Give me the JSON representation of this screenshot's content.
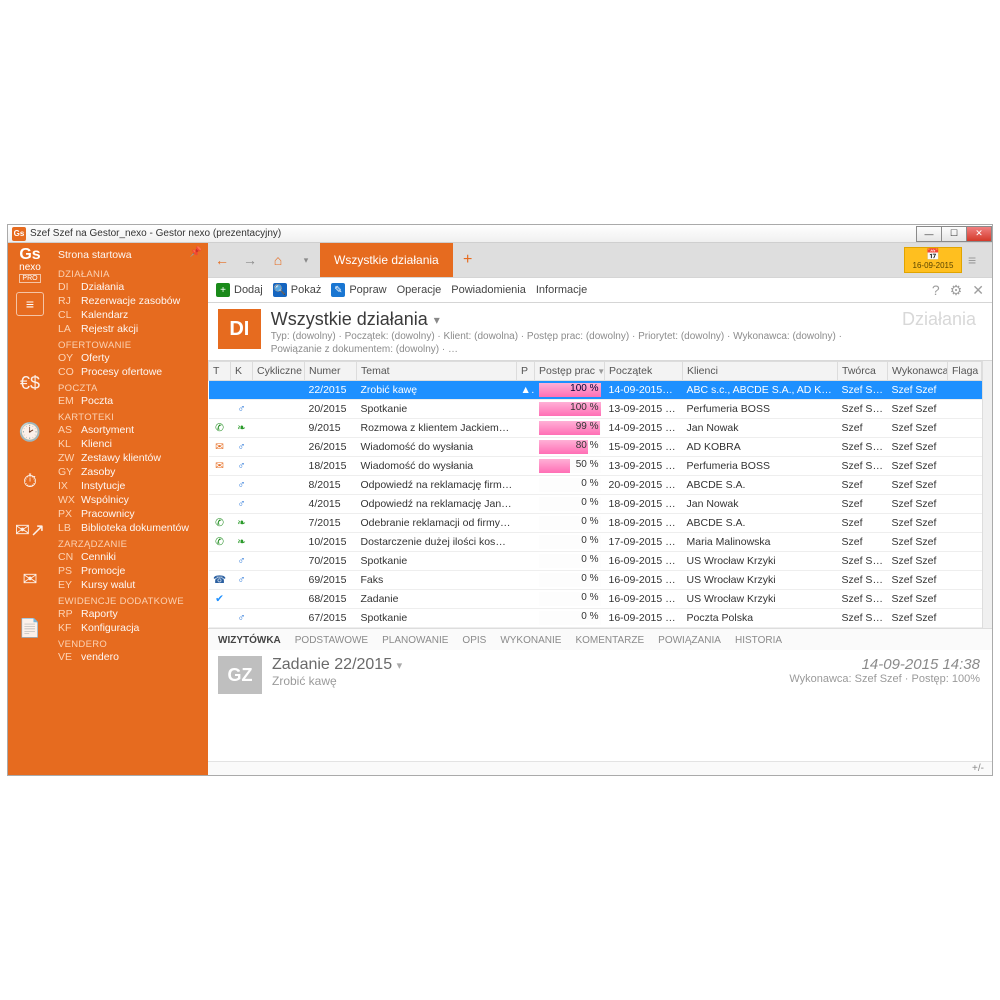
{
  "window": {
    "title": "Szef Szef na Gestor_nexo - Gestor nexo (prezentacyjny)",
    "logo_line1": "Gs",
    "logo_line2": "nexo",
    "logo_line3": "PRO"
  },
  "nav": {
    "start": "Strona startowa",
    "groups": [
      {
        "label": "DZIAŁANIA",
        "items": [
          {
            "code": "DI",
            "label": "Działania"
          },
          {
            "code": "RJ",
            "label": "Rezerwacje zasobów"
          },
          {
            "code": "CL",
            "label": "Kalendarz"
          },
          {
            "code": "LA",
            "label": "Rejestr akcji"
          }
        ]
      },
      {
        "label": "OFERTOWANIE",
        "items": [
          {
            "code": "OY",
            "label": "Oferty"
          },
          {
            "code": "CO",
            "label": "Procesy ofertowe"
          }
        ]
      },
      {
        "label": "POCZTA",
        "items": [
          {
            "code": "EM",
            "label": "Poczta"
          }
        ]
      },
      {
        "label": "KARTOTEKI",
        "items": [
          {
            "code": "AS",
            "label": "Asortyment"
          },
          {
            "code": "KL",
            "label": "Klienci"
          },
          {
            "code": "ZW",
            "label": "Zestawy klientów"
          },
          {
            "code": "GY",
            "label": "Zasoby"
          },
          {
            "code": "IX",
            "label": "Instytucje"
          },
          {
            "code": "WX",
            "label": "Wspólnicy"
          },
          {
            "code": "PX",
            "label": "Pracownicy"
          },
          {
            "code": "LB",
            "label": "Biblioteka dokumentów"
          }
        ]
      },
      {
        "label": "ZARZĄDZANIE",
        "items": [
          {
            "code": "CN",
            "label": "Cenniki"
          },
          {
            "code": "PS",
            "label": "Promocje"
          },
          {
            "code": "EY",
            "label": "Kursy walut"
          }
        ]
      },
      {
        "label": "EWIDENCJE DODATKOWE",
        "items": [
          {
            "code": "RP",
            "label": "Raporty"
          },
          {
            "code": "KF",
            "label": "Konfiguracja"
          }
        ]
      },
      {
        "label": "VENDERO",
        "items": [
          {
            "code": "VE",
            "label": "vendero"
          }
        ]
      }
    ]
  },
  "tabbar": {
    "tab": "Wszystkie działania",
    "date": "16-09-2015"
  },
  "toolbar": {
    "add": "Dodaj",
    "show": "Pokaż",
    "edit": "Popraw",
    "ops": "Operacje",
    "notif": "Powiadomienia",
    "info": "Informacje"
  },
  "header": {
    "badge": "DI",
    "title": "Wszystkie działania",
    "subtitle": "Typ: (dowolny) · Początek: (dowolny) · Klient: (dowolna) · Postęp prac: (dowolny) · Priorytet: (dowolny) · Wykonawca: (dowolny) · Powiązanie z dokumentem: (dowolny) · …",
    "module": "Działania"
  },
  "columns": {
    "t": "T",
    "k": "K",
    "cyc": "Cykliczne",
    "num": "Numer",
    "subj": "Temat",
    "p": "P",
    "prog": "Postęp prac",
    "start": "Początek",
    "client": "Klienci",
    "creator": "Twórca",
    "exec": "Wykonawca",
    "flag": "Flaga"
  },
  "rows": [
    {
      "t": "check",
      "k": "",
      "num": "22/2015",
      "subj": "Zrobić kawę",
      "p": "▲",
      "prog": 100,
      "start": "14-09-2015…",
      "client": "ABC s.c., ABCDE S.A., AD KOBRA",
      "creator": "Szef Szef",
      "exec": "Szef Szef",
      "sel": true
    },
    {
      "t": "",
      "k": "male",
      "num": "20/2015",
      "subj": "Spotkanie",
      "prog": 100,
      "start": "13-09-2015 1…",
      "client": "Perfumeria BOSS",
      "creator": "Szef Szef",
      "exec": "Szef Szef"
    },
    {
      "t": "phone",
      "k": "leaf",
      "num": "9/2015",
      "subj": "Rozmowa z klientem Jackiem…",
      "prog": 99,
      "start": "14-09-2015 1…",
      "client": "Jan Nowak",
      "creator": "Szef",
      "exec": "Szef Szef"
    },
    {
      "t": "env",
      "k": "male",
      "num": "26/2015",
      "subj": "Wiadomość do wysłania",
      "prog": 80,
      "start": "15-09-2015 1…",
      "client": "AD KOBRA",
      "creator": "Szef Szef",
      "exec": "Szef Szef"
    },
    {
      "t": "env",
      "k": "male",
      "num": "18/2015",
      "subj": "Wiadomość do wysłania",
      "prog": 50,
      "start": "13-09-2015 1…",
      "client": "Perfumeria BOSS",
      "creator": "Szef Szef",
      "exec": "Szef Szef"
    },
    {
      "t": "",
      "k": "male",
      "num": "8/2015",
      "subj": "Odpowiedź na reklamację firm…",
      "prog": 0,
      "start": "20-09-2015 1…",
      "client": "ABCDE S.A.",
      "creator": "Szef",
      "exec": "Szef Szef"
    },
    {
      "t": "",
      "k": "male",
      "num": "4/2015",
      "subj": "Odpowiedź na reklamację Jana…",
      "prog": 0,
      "start": "18-09-2015 1…",
      "client": "Jan Nowak",
      "creator": "Szef",
      "exec": "Szef Szef"
    },
    {
      "t": "phone",
      "k": "leaf",
      "num": "7/2015",
      "subj": "Odebranie reklamacji od firmy…",
      "prog": 0,
      "start": "18-09-2015 1…",
      "client": "ABCDE S.A.",
      "creator": "Szef",
      "exec": "Szef Szef"
    },
    {
      "t": "phone",
      "k": "leaf",
      "num": "10/2015",
      "subj": "Dostarczenie dużej ilości kosm…",
      "prog": 0,
      "start": "17-09-2015 1…",
      "client": "Maria Malinowska",
      "creator": "Szef",
      "exec": "Szef Szef"
    },
    {
      "t": "",
      "k": "male",
      "num": "70/2015",
      "subj": "Spotkanie",
      "prog": 0,
      "start": "16-09-2015 1…",
      "client": "US Wrocław Krzyki",
      "creator": "Szef Szef",
      "exec": "Szef Szef"
    },
    {
      "t": "fax",
      "k": "male",
      "num": "69/2015",
      "subj": "Faks",
      "prog": 0,
      "start": "16-09-2015 1…",
      "client": "US Wrocław Krzyki",
      "creator": "Szef Szef",
      "exec": "Szef Szef"
    },
    {
      "t": "check",
      "k": "",
      "num": "68/2015",
      "subj": "Zadanie",
      "prog": 0,
      "start": "16-09-2015 1…",
      "client": "US Wrocław Krzyki",
      "creator": "Szef Szef",
      "exec": "Szef Szef"
    },
    {
      "t": "",
      "k": "male",
      "num": "67/2015",
      "subj": "Spotkanie",
      "prog": 0,
      "start": "16-09-2015 1…",
      "client": "Poczta Polska",
      "creator": "Szef Szef",
      "exec": "Szef Szef"
    }
  ],
  "dtabs": [
    "WIZYTÓWKA",
    "PODSTAWOWE",
    "PLANOWANIE",
    "OPIS",
    "WYKONANIE",
    "KOMENTARZE",
    "POWIĄZANIA",
    "HISTORIA"
  ],
  "detail": {
    "badge": "GZ",
    "title": "Zadanie 22/2015",
    "subtitle": "Zrobić kawę",
    "datetime": "14-09-2015 14:38",
    "meta": "Wykonawca: Szef Szef · Postęp: 100%"
  },
  "footer": "+/-"
}
